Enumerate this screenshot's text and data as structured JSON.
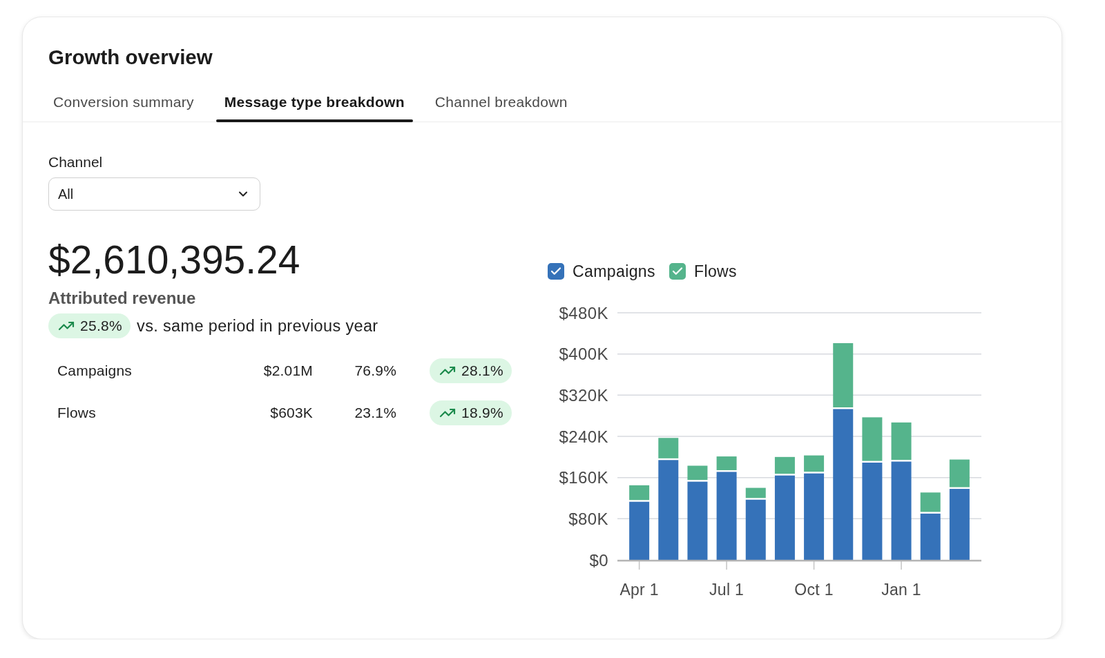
{
  "title": "Growth overview",
  "tabs": [
    {
      "label": "Conversion summary",
      "selected": false
    },
    {
      "label": "Message type breakdown",
      "selected": true
    },
    {
      "label": "Channel breakdown",
      "selected": false
    }
  ],
  "filter": {
    "label": "Channel",
    "value": "All"
  },
  "summary": {
    "total": "$2,610,395.24",
    "caption": "Attributed revenue",
    "change": "25.8%",
    "comparison": "vs. same period in previous year"
  },
  "breakdown": [
    {
      "name": "Campaigns",
      "revenue": "$2.01M",
      "share": "76.9%",
      "change": "28.1%"
    },
    {
      "name": "Flows",
      "revenue": "$603K",
      "share": "23.1%",
      "change": "18.9%"
    }
  ],
  "chart": {
    "legend": [
      {
        "checked": true
      },
      {
        "checked": true
      }
    ],
    "chart_data": {
      "type": "bar",
      "stacked": true,
      "grid": true,
      "categories": [
        "Apr 1",
        null,
        null,
        "Jul 1",
        null,
        null,
        "Oct 1",
        null,
        null,
        "Jan 1",
        null,
        null
      ],
      "series": [
        {
          "name": "Campaigns",
          "color": "#3572b9",
          "values": [
            113000,
            194000,
            152000,
            171000,
            117000,
            164000,
            168000,
            293000,
            189000,
            191000,
            90000,
            138000
          ]
        },
        {
          "name": "Flows",
          "color": "#55b48c",
          "values": [
            32000,
            43000,
            31000,
            30000,
            23000,
            36000,
            35000,
            128000,
            88000,
            76000,
            41000,
            57000
          ]
        }
      ],
      "ylim": [
        0,
        480000
      ],
      "yticks": [
        {
          "value": 0,
          "label": "$0"
        },
        {
          "value": 80000,
          "label": "$80K"
        },
        {
          "value": 160000,
          "label": "$160K"
        },
        {
          "value": 240000,
          "label": "$240K"
        },
        {
          "value": 320000,
          "label": "$320K"
        },
        {
          "value": 400000,
          "label": "$400K"
        },
        {
          "value": 480000,
          "label": "$480K"
        }
      ]
    }
  }
}
